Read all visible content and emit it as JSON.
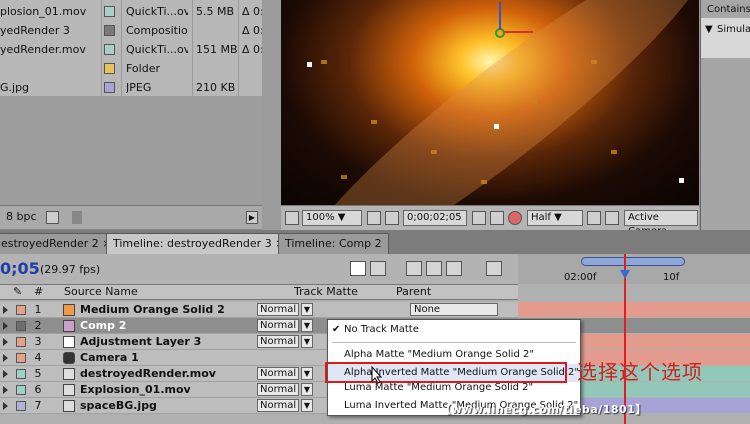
{
  "project": {
    "items": [
      {
        "name": "plosion_01.mov",
        "type": "QuickTi...ovie",
        "size": "5.5 MB",
        "dur": "Δ 0:",
        "label_color": "#a8d0c8"
      },
      {
        "name": "yedRender 3",
        "type": "Composition",
        "size": "",
        "dur": "Δ 0:",
        "label_color": "#7a7a7a"
      },
      {
        "name": "yedRender.mov",
        "type": "QuickTi...ovie",
        "size": "151 MB",
        "dur": "Δ 0:",
        "label_color": "#a8d0c8"
      },
      {
        "name": "",
        "type": "Folder",
        "size": "",
        "dur": "",
        "label_color": "#e8c25a"
      },
      {
        "name": "G.jpg",
        "type": "JPEG",
        "size": "210 KB",
        "dur": "",
        "label_color": "#a8a4d8"
      }
    ],
    "bpc": "8 bpc"
  },
  "viewer": {
    "zoom": "100%",
    "timecode": "0;00;02;05",
    "resolution": "Half",
    "camera": "Active Camera"
  },
  "info_panel": {
    "contains": "Contains",
    "simula": "Simula"
  },
  "tabs": [
    {
      "label": "estroyedRender 2",
      "active": false
    },
    {
      "label": "Timeline: destroyedRender 3",
      "active": true
    },
    {
      "label": "Timeline: Comp 2",
      "active": false
    }
  ],
  "timeline": {
    "timecode": "0;05",
    "fps": "(29.97 fps)",
    "columns": {
      "hash": "#",
      "source": "Source Name",
      "matte": "Track Matte",
      "parent": "Parent"
    },
    "ruler_ticks": [
      "02:00f",
      "10f"
    ],
    "layers": [
      {
        "num": "1",
        "name": "Medium Orange Solid 2",
        "mode": "Normal",
        "parent": "None",
        "label_color": "#e2a38a",
        "icon": "solid-icon",
        "icon_color": "#f09a4a",
        "bar_color": "#e29b8c",
        "selected": false
      },
      {
        "num": "2",
        "name": "Comp 2",
        "mode": "Normal",
        "parent": "",
        "label_color": "#6e6e6e",
        "icon": "composition-icon",
        "icon_color": "#c8a0c8",
        "bar_color": "#8e8e8e",
        "selected": true
      },
      {
        "num": "3",
        "name": "Adjustment Layer 3",
        "mode": "Normal",
        "parent": "",
        "label_color": "#e2a38a",
        "icon": "adjustment-icon",
        "icon_color": "#ffffff",
        "bar_color": "#e29b8c",
        "selected": false
      },
      {
        "num": "4",
        "name": "Camera 1",
        "mode": "",
        "parent": "",
        "label_color": "#e2a38a",
        "icon": "camera-icon",
        "icon_color": "#333333",
        "bar_color": "#e29b8c",
        "selected": false
      },
      {
        "num": "5",
        "name": "destroyedRender.mov",
        "mode": "Normal",
        "parent": "",
        "label_color": "#9ed0c4",
        "icon": "footage-icon",
        "icon_color": "#dddddd",
        "bar_color": "#92c8b8",
        "selected": false
      },
      {
        "num": "6",
        "name": "Explosion_01.mov",
        "mode": "Normal",
        "parent": "",
        "label_color": "#9ed0c4",
        "icon": "footage-icon",
        "icon_color": "#dddddd",
        "bar_color": "#92c8b8",
        "selected": false
      },
      {
        "num": "7",
        "name": "spaceBG.jpg",
        "mode": "Normal",
        "parent": "",
        "label_color": "#b4b0dc",
        "icon": "image-icon",
        "icon_color": "#dddddd",
        "bar_color": "#a8a2d6",
        "selected": false
      }
    ]
  },
  "track_matte_menu": {
    "items": [
      {
        "label": "No Track Matte",
        "checked": true
      },
      {
        "label": "Alpha Matte \"Medium Orange Solid 2\"",
        "checked": false
      },
      {
        "label": "Alpha Inverted Matte \"Medium Orange Solid 2\"",
        "checked": false
      },
      {
        "label": "Luma Matte \"Medium Orange Solid 2\"",
        "checked": false
      },
      {
        "label": "Luma Inverted Matte \"Medium Orange Solid 2\"",
        "checked": false
      }
    ]
  },
  "annotation": "选择这个选项",
  "watermark": "【www.linecg.com/tieba/1801】",
  "colors": {
    "playhead": "#e02020",
    "highlight": "#e01818",
    "timecode": "#1f3fa8"
  }
}
